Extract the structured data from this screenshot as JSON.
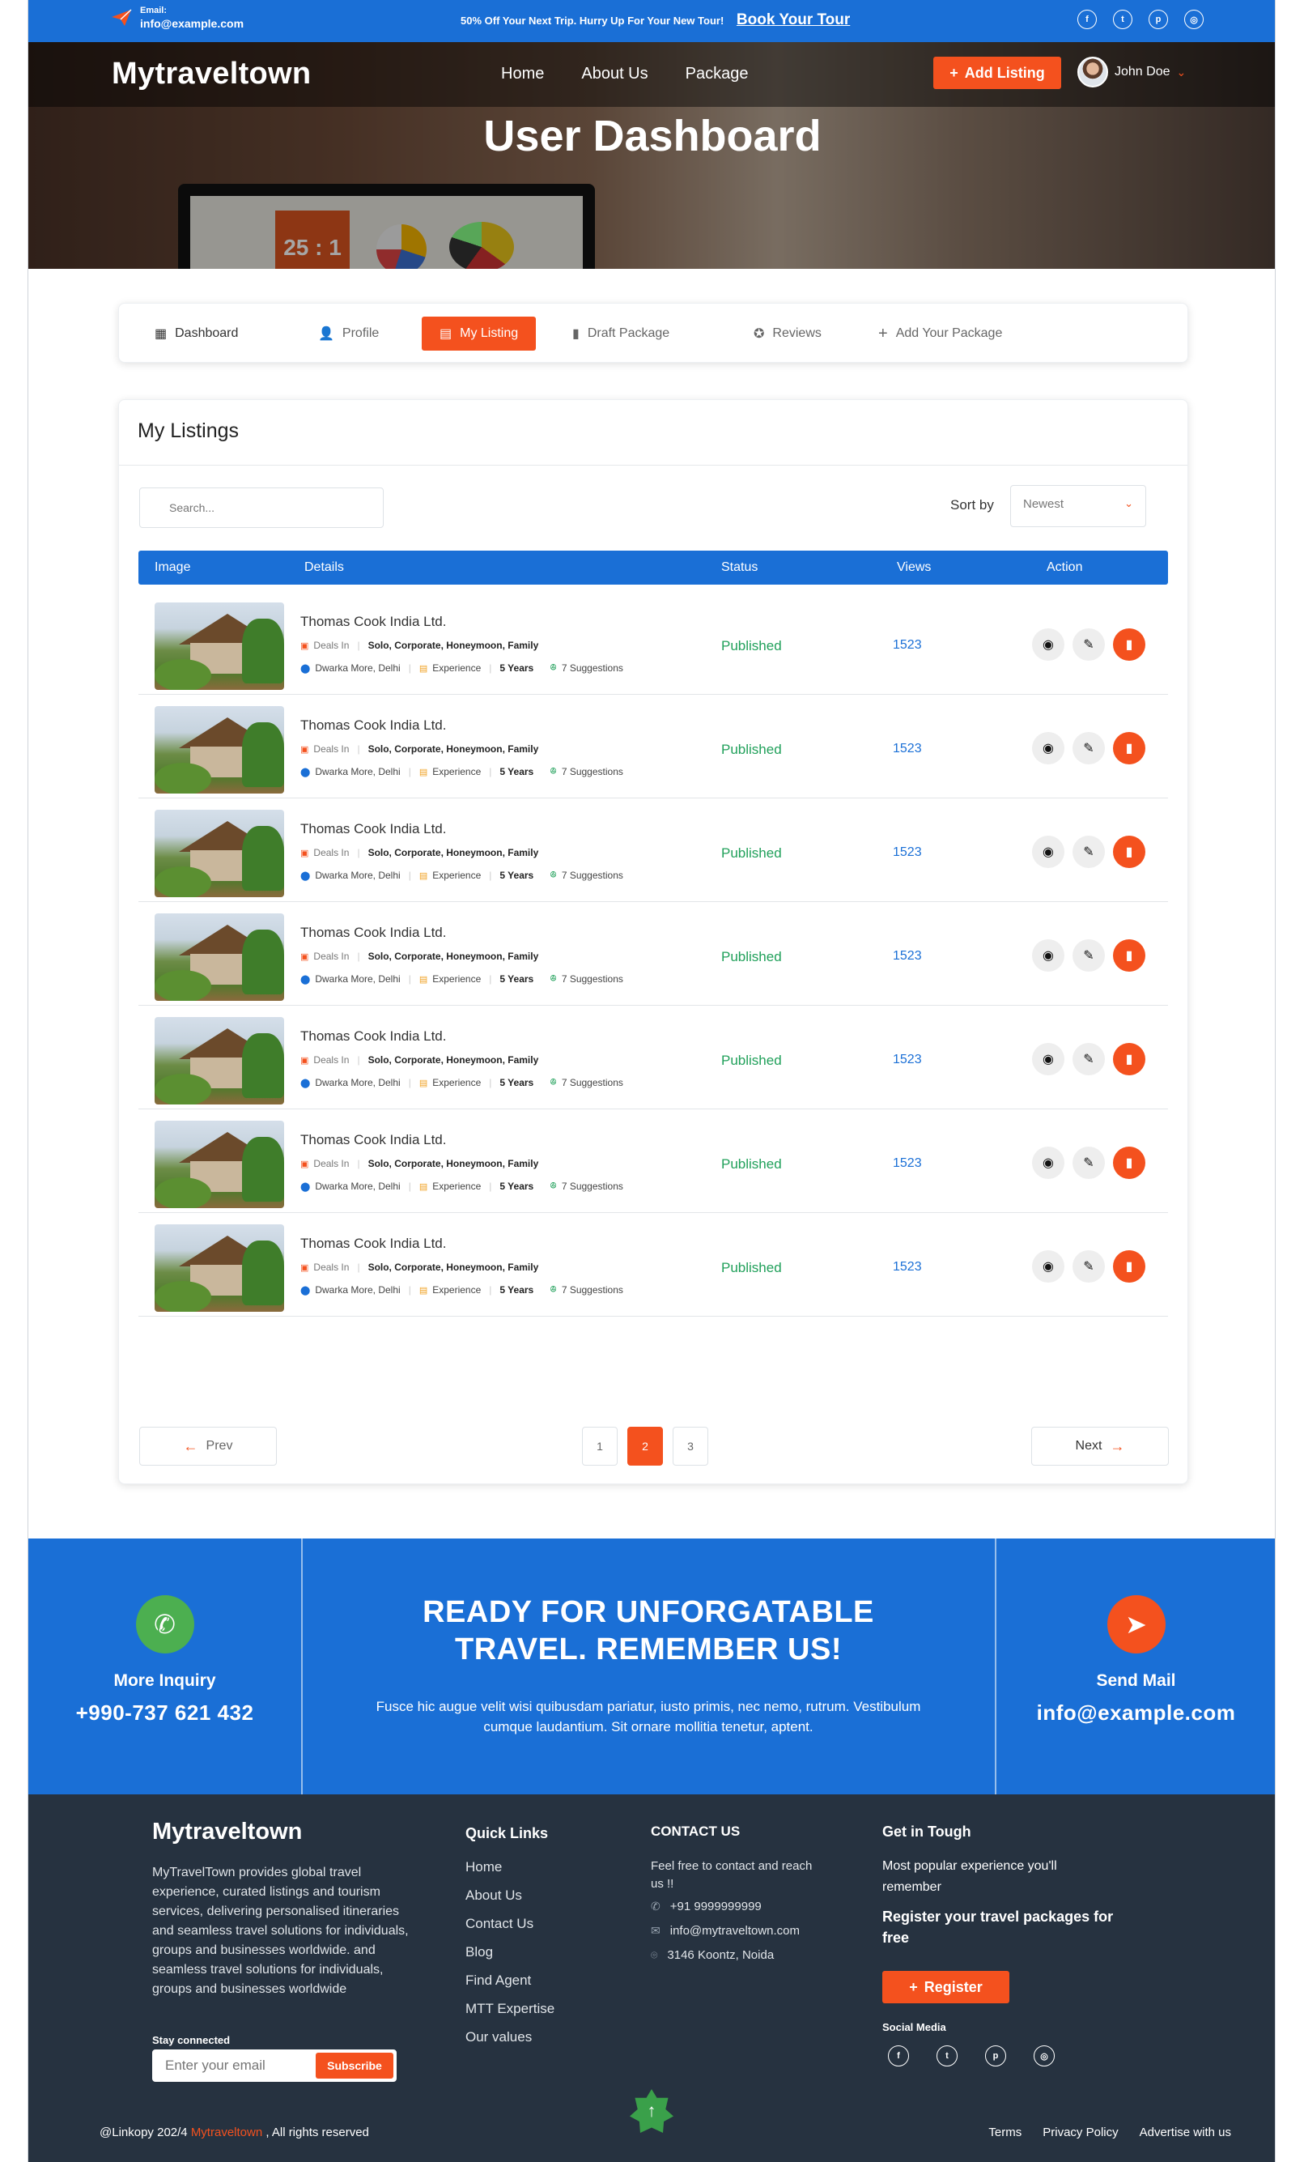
{
  "topbar": {
    "email_label": "Email:",
    "email": "info@example.com",
    "promo": "50% Off Your Next Trip. Hurry Up For Your New Tour!",
    "promo_link": "Book Your Tour",
    "socials": [
      "f",
      "t",
      "p",
      "i"
    ]
  },
  "header": {
    "logo": "Mytraveltown",
    "nav": [
      "Home",
      "About Us",
      "Package"
    ],
    "add_listing": "Add Listing",
    "user_name": "John Doe",
    "hero_title": "User Dashboard",
    "hero_card_value": "25 : 1"
  },
  "tabs": [
    {
      "label": "Dashboard",
      "icon": "grid-icon"
    },
    {
      "label": "Profile",
      "icon": "user-icon"
    },
    {
      "label": "My Listing",
      "icon": "list-icon",
      "active": true
    },
    {
      "label": "Draft Package",
      "icon": "file-icon"
    },
    {
      "label": "Reviews",
      "icon": "star-message-icon"
    },
    {
      "label": "Add Your Package",
      "icon": "plus-icon"
    }
  ],
  "listings": {
    "title": "My Listings",
    "search_placeholder": "Search...",
    "sort_label": "Sort by",
    "sort_value": "Newest",
    "columns": [
      "Image",
      "Details",
      "Status",
      "Views",
      "Action"
    ],
    "rows": [
      {
        "name": "Thomas Cook India Ltd.",
        "deals_label": "Deals In",
        "deals": "Solo, Corporate, Honeymoon, Family",
        "location": "Dwarka More, Delhi",
        "exp_label": "Experience",
        "exp": "5 Years",
        "suggestions": "7 Suggestions",
        "status": "Published",
        "views": "1523"
      },
      {
        "name": "Thomas Cook India Ltd.",
        "deals_label": "Deals In",
        "deals": "Solo, Corporate, Honeymoon, Family",
        "location": "Dwarka More, Delhi",
        "exp_label": "Experience",
        "exp": "5 Years",
        "suggestions": "7 Suggestions",
        "status": "Published",
        "views": "1523"
      },
      {
        "name": "Thomas Cook India Ltd.",
        "deals_label": "Deals In",
        "deals": "Solo, Corporate, Honeymoon, Family",
        "location": "Dwarka More, Delhi",
        "exp_label": "Experience",
        "exp": "5 Years",
        "suggestions": "7 Suggestions",
        "status": "Published",
        "views": "1523"
      },
      {
        "name": "Thomas Cook India Ltd.",
        "deals_label": "Deals In",
        "deals": "Solo, Corporate, Honeymoon, Family",
        "location": "Dwarka More, Delhi",
        "exp_label": "Experience",
        "exp": "5 Years",
        "suggestions": "7 Suggestions",
        "status": "Published",
        "views": "1523"
      },
      {
        "name": "Thomas Cook India Ltd.",
        "deals_label": "Deals In",
        "deals": "Solo, Corporate, Honeymoon, Family",
        "location": "Dwarka More, Delhi",
        "exp_label": "Experience",
        "exp": "5 Years",
        "suggestions": "7 Suggestions",
        "status": "Published",
        "views": "1523"
      },
      {
        "name": "Thomas Cook India Ltd.",
        "deals_label": "Deals In",
        "deals": "Solo, Corporate, Honeymoon, Family",
        "location": "Dwarka More, Delhi",
        "exp_label": "Experience",
        "exp": "5 Years",
        "suggestions": "7 Suggestions",
        "status": "Published",
        "views": "1523"
      },
      {
        "name": "Thomas Cook India Ltd.",
        "deals_label": "Deals In",
        "deals": "Solo, Corporate, Honeymoon, Family",
        "location": "Dwarka More, Delhi",
        "exp_label": "Experience",
        "exp": "5 Years",
        "suggestions": "7 Suggestions",
        "status": "Published",
        "views": "1523"
      }
    ],
    "prev": "Prev",
    "next": "Next",
    "pages": [
      "1",
      "2",
      "3"
    ],
    "current_page": "2"
  },
  "cta": {
    "left_label": "More Inquiry",
    "left_value": "+990-737 621 432",
    "headline_1": "READY FOR UNFORGATABLE",
    "headline_2": "TRAVEL. REMEMBER US!",
    "paragraph": "Fusce hic augue velit wisi quibusdam pariatur, iusto primis, nec nemo, rutrum. Vestibulum cumque laudantium. Sit ornare mollitia tenetur, aptent.",
    "right_label": "Send Mail",
    "right_value": "info@example.com"
  },
  "footer": {
    "logo": "Mytraveltown",
    "about": "MyTravelTown provides global travel experience, curated listings and tourism services, delivering personalised itineraries and seamless travel solutions for individuals, groups and businesses worldwide.  and seamless travel solutions for individuals, groups and businesses worldwide",
    "stay_connected": "Stay connected",
    "email_placeholder": "Enter your email",
    "subscribe": "Subscribe",
    "quick_links_title": "Quick Links",
    "quick_links": [
      "Home",
      "About Us",
      "Contact Us",
      "Blog",
      "Find Agent",
      "MTT Expertise",
      "Our values"
    ],
    "contact_title": "CONTACT US",
    "contact_intro": "Feel free to contact and reach us !!",
    "phone": "+91 9999999999",
    "email": "info@mytraveltown.com",
    "address": "3146 Koontz, Noida",
    "get_title": "Get in Tough",
    "get_text": "Most popular experience you'll remember",
    "register_title": "Register your travel packages for free",
    "register": "Register",
    "social_title": "Social Media",
    "copyright_prefix": "@Linkopy 202/4",
    "copyright_brand": "Mytraveltown",
    "copyright_suffix": ", All rights reserved",
    "legal": [
      "Terms",
      "Privacy Policy",
      "Advertise with us"
    ]
  },
  "colors": {
    "primary_blue": "#1a6fd6",
    "accent_orange": "#f4511e",
    "status_green": "#20a05a",
    "footer_bg": "#263240"
  }
}
